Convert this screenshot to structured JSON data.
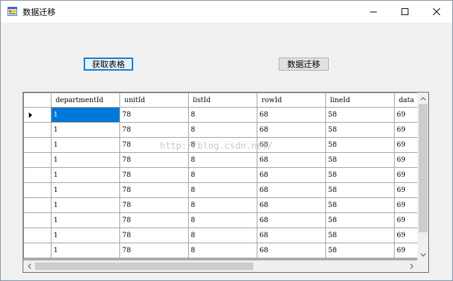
{
  "window": {
    "title": "数据迁移",
    "icon": "app-window-icon"
  },
  "controls": {
    "minimize": "minimize-icon",
    "maximize": "maximize-icon",
    "close": "close-icon"
  },
  "buttons": {
    "get_table": "获取表格",
    "migrate": "数据迁移"
  },
  "grid": {
    "columns": [
      "departmentId",
      "unitId",
      "listId",
      "rowId",
      "lineId",
      "data"
    ],
    "rows": [
      [
        "1",
        "78",
        "8",
        "68",
        "58",
        "69"
      ],
      [
        "1",
        "78",
        "8",
        "68",
        "58",
        "69"
      ],
      [
        "1",
        "78",
        "8",
        "68",
        "58",
        "69"
      ],
      [
        "1",
        "78",
        "8",
        "68",
        "58",
        "69"
      ],
      [
        "1",
        "78",
        "8",
        "68",
        "58",
        "69"
      ],
      [
        "1",
        "78",
        "8",
        "68",
        "58",
        "69"
      ],
      [
        "1",
        "78",
        "8",
        "68",
        "58",
        "69"
      ],
      [
        "1",
        "78",
        "8",
        "68",
        "58",
        "69"
      ],
      [
        "1",
        "78",
        "8",
        "68",
        "58",
        "69"
      ],
      [
        "1",
        "78",
        "8",
        "68",
        "58",
        "69"
      ]
    ],
    "current_row_indicator": "row-pointer-icon",
    "selected_cell": "row 1, departmentId"
  },
  "watermark": "http://blog.csdn.net/",
  "colors": {
    "selection": "#0078d7",
    "focus_border": "#0078d7",
    "window_bg": "#f0f0f0"
  }
}
